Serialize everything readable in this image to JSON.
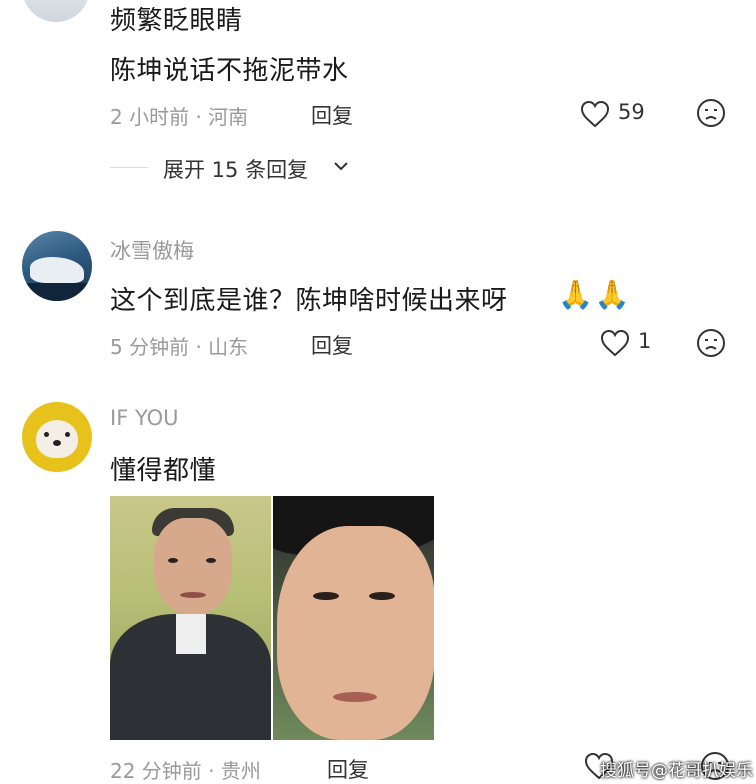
{
  "comments": [
    {
      "line1": "频繁眨眼睛",
      "line2": "陈坤说话不拖泥带水",
      "time": "2 小时前 · 河南",
      "reply_label": "回复",
      "like_count": "59",
      "expand_label": "展开 15 条回复"
    },
    {
      "username": "冰雪傲梅",
      "text": "这个到底是谁？陈坤啥时候出来呀",
      "emoji": "🙏🙏",
      "time": "5 分钟前 · 山东",
      "reply_label": "回复",
      "like_count": "1"
    },
    {
      "username": "IF YOU",
      "text": "懂得都懂",
      "time": "22 分钟前 · 贵州",
      "reply_label": "回复"
    }
  ],
  "watermark": "搜狐号@花哥扒娱乐",
  "icons": [
    "heart-icon",
    "dislike-face-icon",
    "chevron-down-icon"
  ],
  "colors": {
    "text": "#1a1a1a",
    "meta": "#9a9a9a",
    "accent": "#333333"
  }
}
